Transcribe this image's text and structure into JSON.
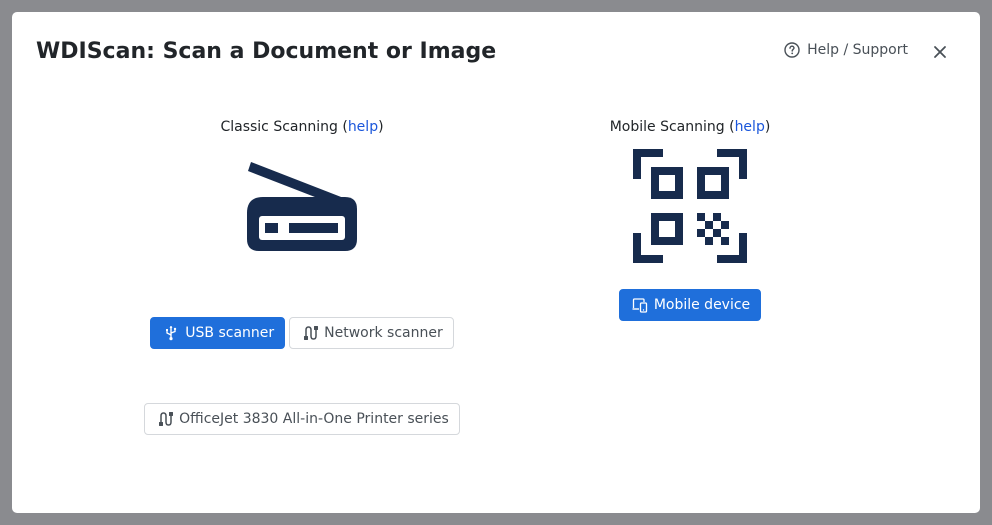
{
  "modal": {
    "title": "WDIScan: Scan a Document or Image",
    "help_support_label": "Help / Support",
    "close_icon": "close-icon"
  },
  "classic": {
    "title": "Classic Scanning",
    "help_open": " (",
    "help_label": "help",
    "help_close": ")",
    "illustration_icon": "flatbed-scanner-icon",
    "buttons": {
      "usb_label": "USB scanner",
      "usb_icon": "usb-icon",
      "network_label": "Network scanner",
      "network_icon": "network-icon",
      "device_label": "OfficeJet 3830 All-in-One Printer series",
      "device_icon": "network-icon"
    }
  },
  "mobile": {
    "title": "Mobile Scanning",
    "help_open": " (",
    "help_label": "help",
    "help_close": ")",
    "illustration_icon": "qr-code-scan-icon",
    "buttons": {
      "mobile_label": "Mobile device",
      "mobile_icon": "devices-icon"
    }
  },
  "colors": {
    "primary": "#1f6fdb",
    "navy": "#172b4d",
    "link": "#1a56db"
  }
}
